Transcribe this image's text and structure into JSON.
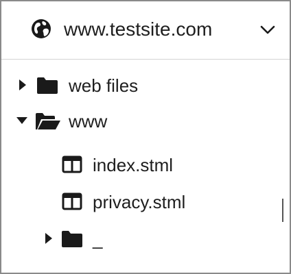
{
  "header": {
    "site_name": "www.testsite.com",
    "globe_icon": "globe-icon",
    "dropdown_icon": "chevron-down-icon"
  },
  "tree": {
    "items": [
      {
        "label": "web files",
        "type": "folder",
        "expanded": false,
        "depth": 0
      },
      {
        "label": "www",
        "type": "folder",
        "expanded": true,
        "depth": 0
      },
      {
        "label": "index.stml",
        "type": "file",
        "depth": 1
      },
      {
        "label": "privacy.stml",
        "type": "file",
        "depth": 1
      },
      {
        "label": "_",
        "type": "folder",
        "expanded": false,
        "depth": 1
      }
    ]
  },
  "colors": {
    "text": "#1e1e1e",
    "icon": "#1a1a1a",
    "border": "#8a8a8a",
    "divider": "#d4d4d4"
  }
}
